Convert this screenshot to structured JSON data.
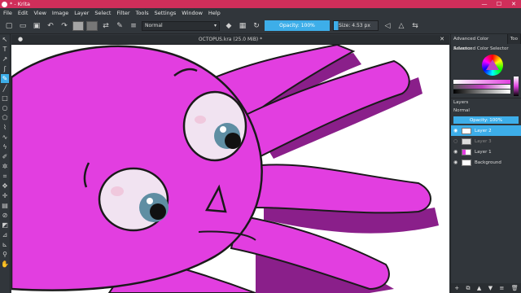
{
  "window": {
    "title": "* - Krita",
    "minimize": "—",
    "maximize": "☐",
    "close": "✕"
  },
  "menu": [
    "File",
    "Edit",
    "View",
    "Image",
    "Layer",
    "Select",
    "Filter",
    "Tools",
    "Settings",
    "Window",
    "Help"
  ],
  "toolbar": {
    "blend_mode": "Normal",
    "opacity_label": "Opacity: 100%",
    "size_label": "Size: 4.53 px",
    "colors": {
      "foreground": "#a5a5a5",
      "background": "#777777",
      "accent": "#3daee9"
    }
  },
  "document": {
    "tab_title": "OCTOPUS.kra (25.0 MiB) *"
  },
  "dock": {
    "tabs": [
      "Advanced Color Selector",
      "Too"
    ],
    "acs_title": "Advanced Color Selector",
    "layers_title": "Layers",
    "layers_mode": "Normal",
    "layers_opacity": "Opacity: 100%",
    "layers": [
      {
        "name": "Layer 2",
        "active": true
      },
      {
        "name": "Layer 3",
        "active": false
      },
      {
        "name": "Layer 1",
        "active": false
      },
      {
        "name": "Background",
        "active": false
      }
    ]
  },
  "canvas": {
    "primary_color": "#e23ee0",
    "shadow_color": "#8a1f8a",
    "outline_color": "#1a1a1a"
  }
}
